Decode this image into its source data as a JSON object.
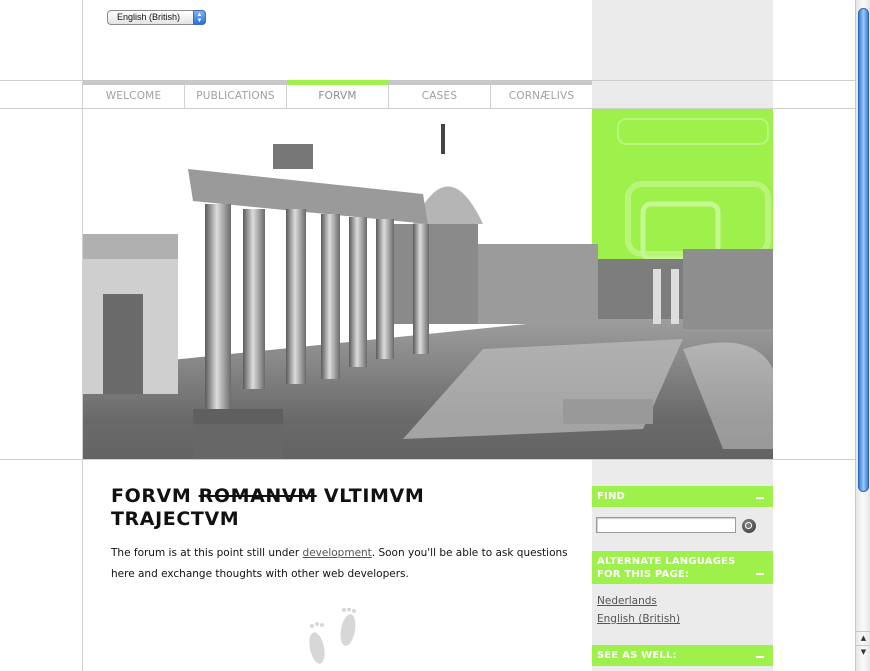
{
  "language_select": {
    "value": "English (British)"
  },
  "nav": {
    "items": [
      {
        "label": "WELCOME"
      },
      {
        "label": "PUBLICATIONS"
      },
      {
        "label": "FORVM"
      },
      {
        "label": "CASES"
      },
      {
        "label": "CORNÆLIVS"
      }
    ],
    "active_index": 2
  },
  "main": {
    "title_part1": "FORVM ",
    "title_strike": "ROMANVM",
    "title_part2": " VLTIMVM TRAJECTVM",
    "intro_before_link": "The forum is at this point still under ",
    "intro_link": "development",
    "intro_after_link": ". Soon you'll be able to ask questions here and exchange thoughts with other web developers."
  },
  "sidebar": {
    "find_heading": "FIND",
    "find_value": "",
    "languages_heading": "ALTERNATE LANGUAGES FOR THIS PAGE:",
    "languages": [
      "Nederlands",
      "English (British)"
    ],
    "see_also_heading": "SEE AS WELL:"
  },
  "colors": {
    "accent": "#9ef04a",
    "sidebar_bg": "#ebebeb",
    "nav_inactive": "#c8c8c8"
  },
  "icons": [
    "chevron-updown-icon",
    "search-icon",
    "minus-icon",
    "footprints-icon",
    "scroll-up-icon",
    "scroll-down-icon"
  ]
}
